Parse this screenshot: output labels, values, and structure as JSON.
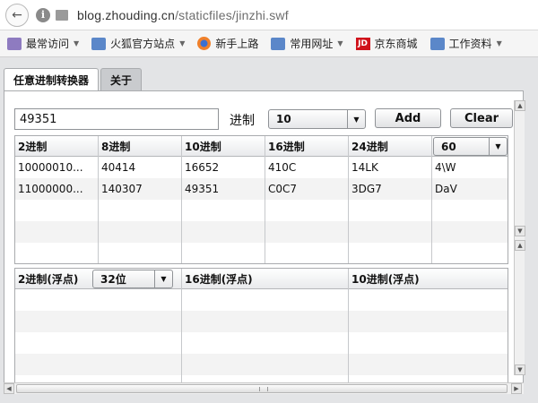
{
  "browser": {
    "url_host": "blog.zhouding.cn",
    "url_path": "/staticfiles/jinzhi.swf",
    "back_glyph": "←"
  },
  "bookmarks": [
    {
      "label": "最常访问",
      "icon": "star-folder-icon",
      "dropdown": true
    },
    {
      "label": "火狐官方站点",
      "icon": "folder-icon",
      "dropdown": true
    },
    {
      "label": "新手上路",
      "icon": "firefox-icon",
      "dropdown": false
    },
    {
      "label": "常用网址",
      "icon": "folder-icon",
      "dropdown": true
    },
    {
      "label": "京东商城",
      "icon": "jd-icon",
      "dropdown": false
    },
    {
      "label": "工作资料",
      "icon": "folder-icon",
      "dropdown": true
    }
  ],
  "jd_text": "JD",
  "tabs": [
    {
      "label": "任意进制转换器",
      "active": true
    },
    {
      "label": "关于",
      "active": false
    }
  ],
  "converter": {
    "input_value": "49351",
    "base_label": "进制",
    "base_value": "10",
    "add_label": "Add",
    "clear_label": "Clear",
    "extra_base": "60"
  },
  "table1": {
    "headers": [
      "2进制",
      "8进制",
      "10进制",
      "16进制",
      "24进制"
    ],
    "rows": [
      [
        "10000010...",
        "40414",
        "16652",
        "410C",
        "14LK",
        "4\\W"
      ],
      [
        "11000000...",
        "140307",
        "49351",
        "C0C7",
        "3DG7",
        "DaV"
      ]
    ]
  },
  "table2": {
    "headers": [
      "2进制(浮点)",
      "16进制(浮点)",
      "10进制(浮点)"
    ],
    "bits_value": "32位"
  },
  "colors": {
    "flash_bg": "#e3e4e6",
    "border": "#a9abae",
    "stripe": "#f3f3f3",
    "jd_red": "#d0121b"
  }
}
